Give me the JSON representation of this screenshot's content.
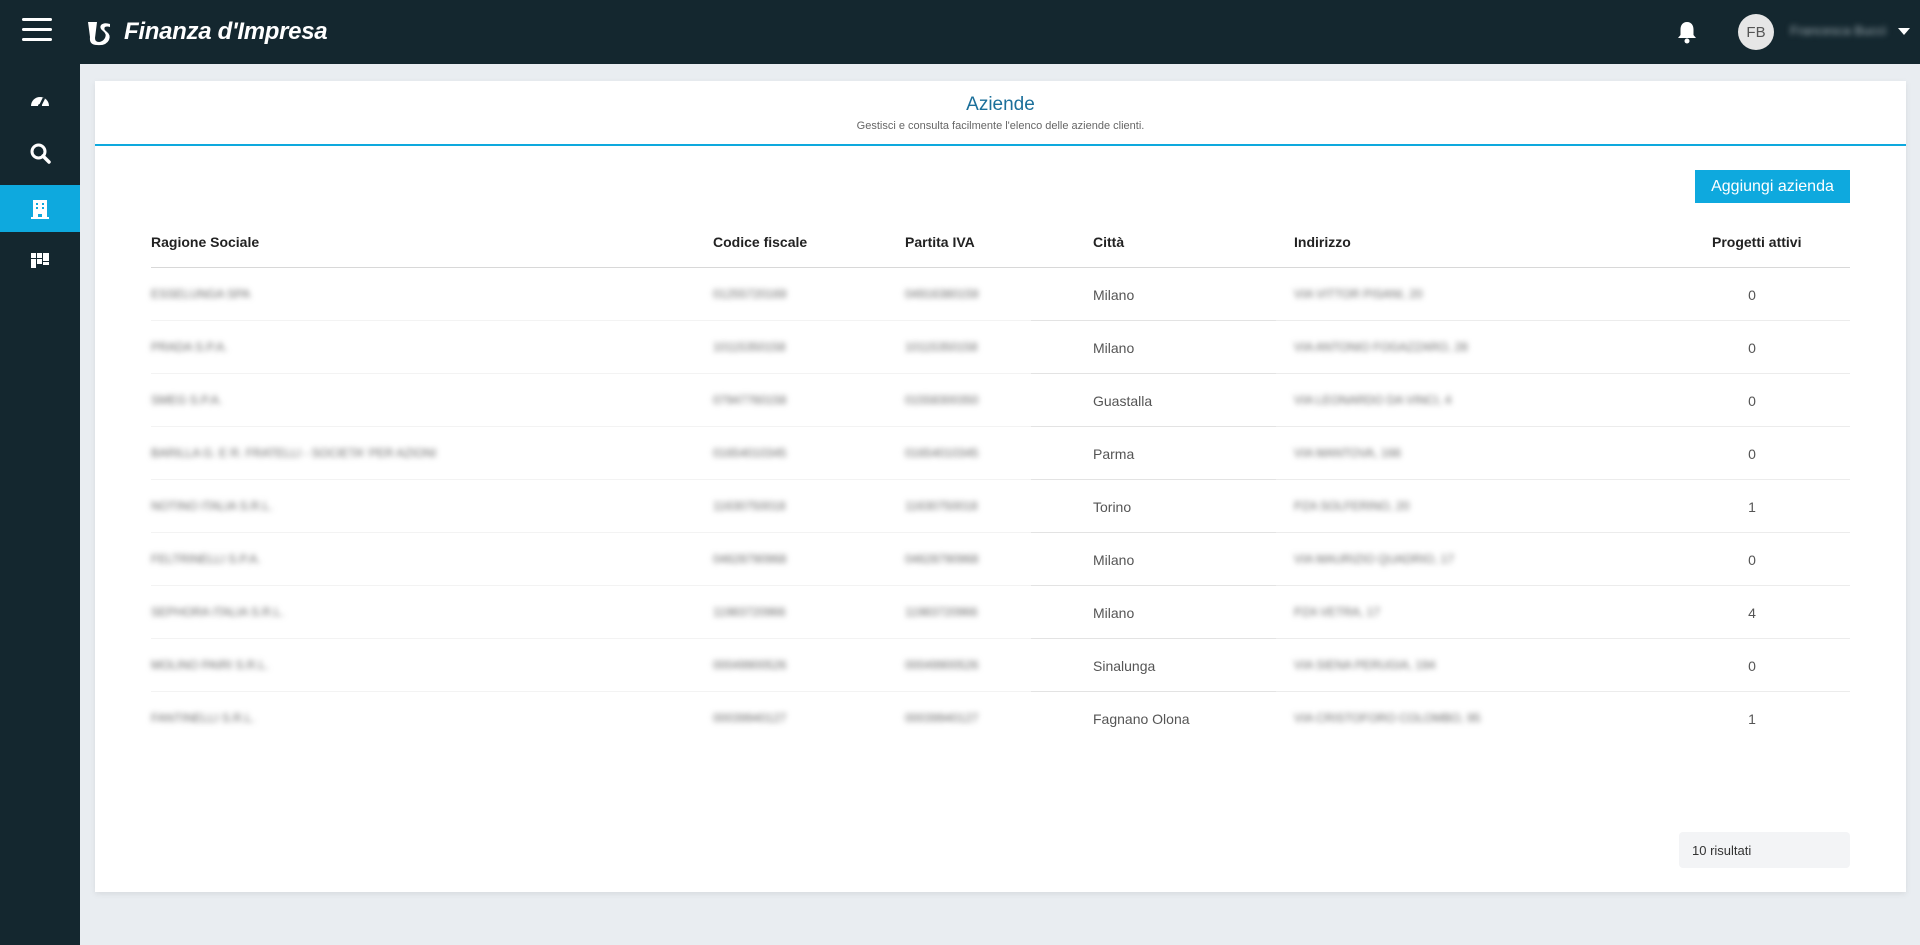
{
  "app": {
    "title": "Finanza d'Impresa"
  },
  "header": {
    "user_initials": "FB",
    "user_name": "Francesca Bucci"
  },
  "page": {
    "title": "Aziende",
    "subtitle": "Gestisci e consulta facilmente l'elenco delle aziende clienti.",
    "add_button": "Aggiungi azienda",
    "result_count": "10 risultati"
  },
  "table": {
    "columns": [
      "Ragione Sociale",
      "Codice fiscale",
      "Partita IVA",
      "Città",
      "Indirizzo",
      "Progetti attivi"
    ],
    "rows": [
      {
        "name": "ESSELUNGA SPA",
        "cf": "01255720169",
        "piva": "04916380159",
        "city": "Milano",
        "address": "VIA VITTOR PISANI, 20",
        "projects": "0"
      },
      {
        "name": "PRADA S.P.A.",
        "cf": "10115350158",
        "piva": "10115350158",
        "city": "Milano",
        "address": "VIA ANTONIO FOGAZZARO, 28",
        "projects": "0"
      },
      {
        "name": "SMEG S.P.A.",
        "cf": "07947760158",
        "piva": "01558300350",
        "city": "Guastalla",
        "address": "VIA LEONARDO DA VINCI, 4",
        "projects": "0"
      },
      {
        "name": "BARILLA G. E R. FRATELLI - SOCIETA' PER AZIONI",
        "cf": "01654010345",
        "piva": "01654010345",
        "city": "Parma",
        "address": "VIA MANTOVA, 166",
        "projects": "0"
      },
      {
        "name": "NOTINO ITALIA S.R.L.",
        "cf": "11630750018",
        "piva": "11630750018",
        "city": "Torino",
        "address": "PZA SOLFERINO, 20",
        "projects": "1"
      },
      {
        "name": "FELTRINELLI S.P.A.",
        "cf": "04628790968",
        "piva": "04628790968",
        "city": "Milano",
        "address": "VIA MAURIZIO QUADRIO, 17",
        "projects": "0"
      },
      {
        "name": "SEPHORA ITALIA S.R.L.",
        "cf": "11983720966",
        "piva": "11983720966",
        "city": "Milano",
        "address": "PZA VETRA, 17",
        "projects": "4"
      },
      {
        "name": "MOLINO PAIRI S.R.L.",
        "cf": "00049900526",
        "piva": "00049900526",
        "city": "Sinalunga",
        "address": "VIA SIENA PERUGIA, 194",
        "projects": "0"
      },
      {
        "name": "FANTINELLI S.R.L.",
        "cf": "00039940127",
        "piva": "00039940127",
        "city": "Fagnano Olona",
        "address": "VIA CRISTOFORO COLOMBO, 95",
        "projects": "1"
      }
    ]
  },
  "colors": {
    "topbar": "#14272f",
    "accent": "#0ea9de",
    "title": "#1b6f9a"
  },
  "icons": {
    "menu": "hamburger-icon",
    "notifications": "bell-icon",
    "dashboard": "gauge-icon",
    "search": "search-icon",
    "companies": "building-icon",
    "projects": "grid-icon"
  }
}
